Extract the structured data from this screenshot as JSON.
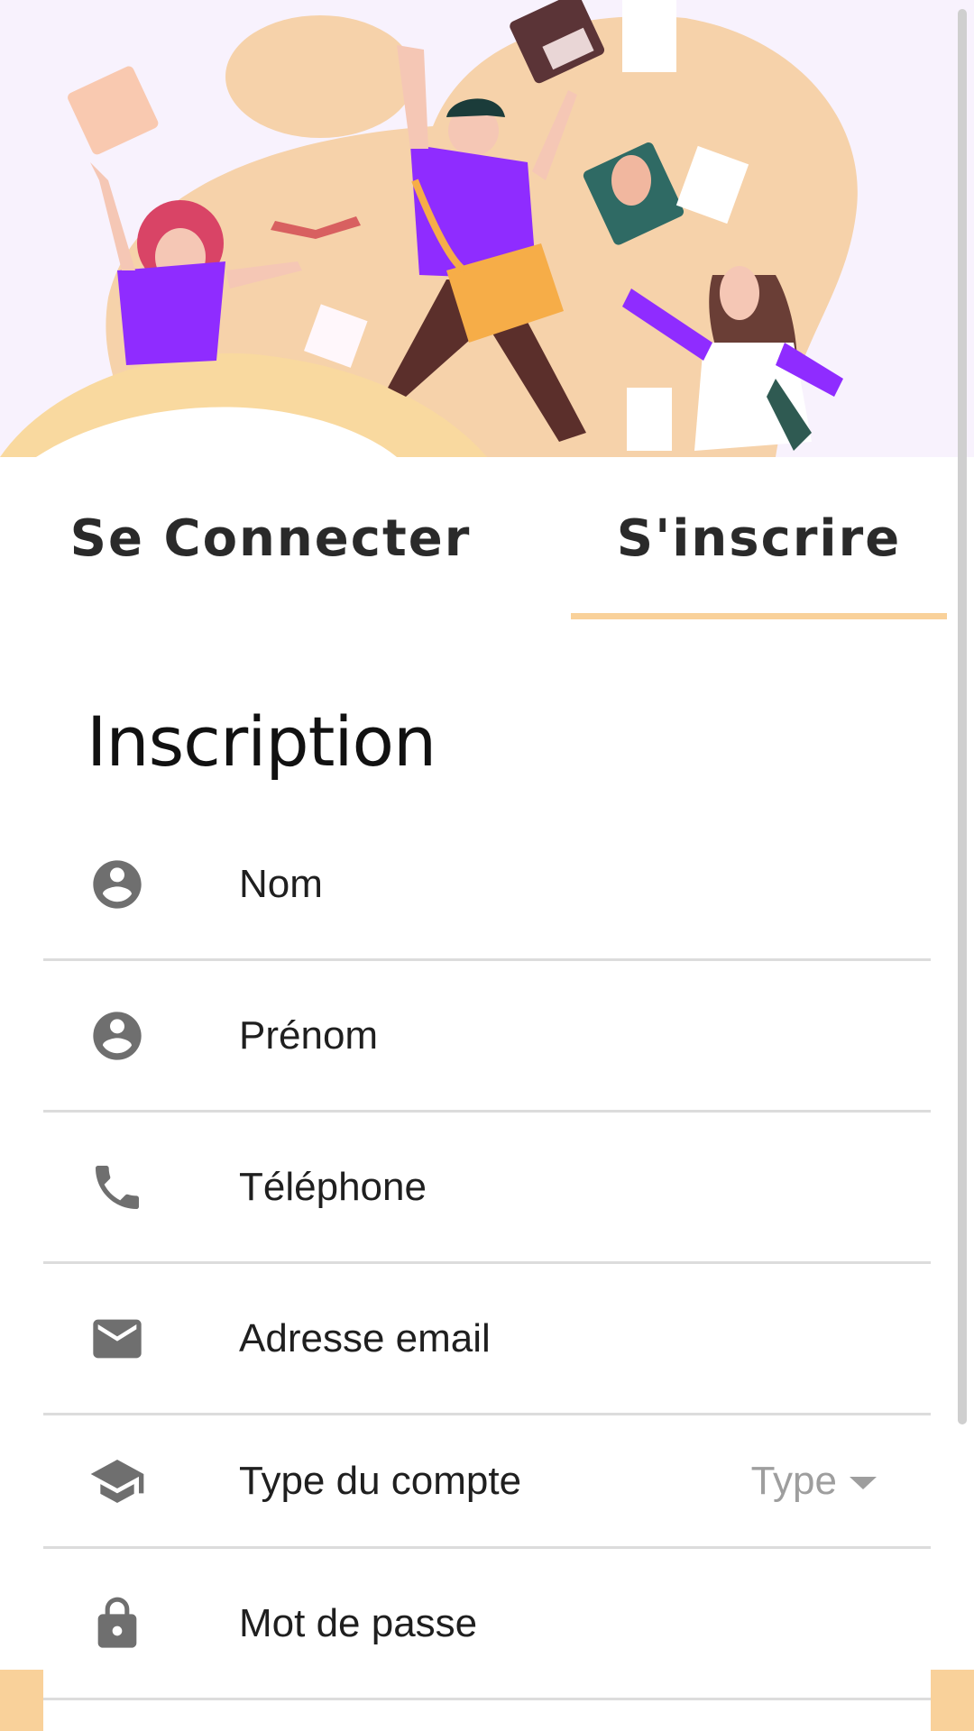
{
  "tabs": {
    "login_label": "Se Connecter",
    "signup_label": "S'inscrire",
    "active": "signup"
  },
  "page": {
    "title": "Inscription"
  },
  "form": {
    "fields": [
      {
        "icon": "account-circle-icon",
        "label": "Nom"
      },
      {
        "icon": "account-circle-icon",
        "label": "Prénom"
      },
      {
        "icon": "phone-icon",
        "label": "Téléphone"
      },
      {
        "icon": "email-icon",
        "label": "Adresse email"
      },
      {
        "icon": "graduation-cap-icon",
        "label": "Type du compte",
        "dropdown_value": "Type"
      },
      {
        "icon": "lock-icon",
        "label": "Mot de passe"
      }
    ]
  },
  "colors": {
    "accent": "#f9d19a",
    "icon": "#6f6f6f",
    "hero_background": "#f8f2fd"
  }
}
